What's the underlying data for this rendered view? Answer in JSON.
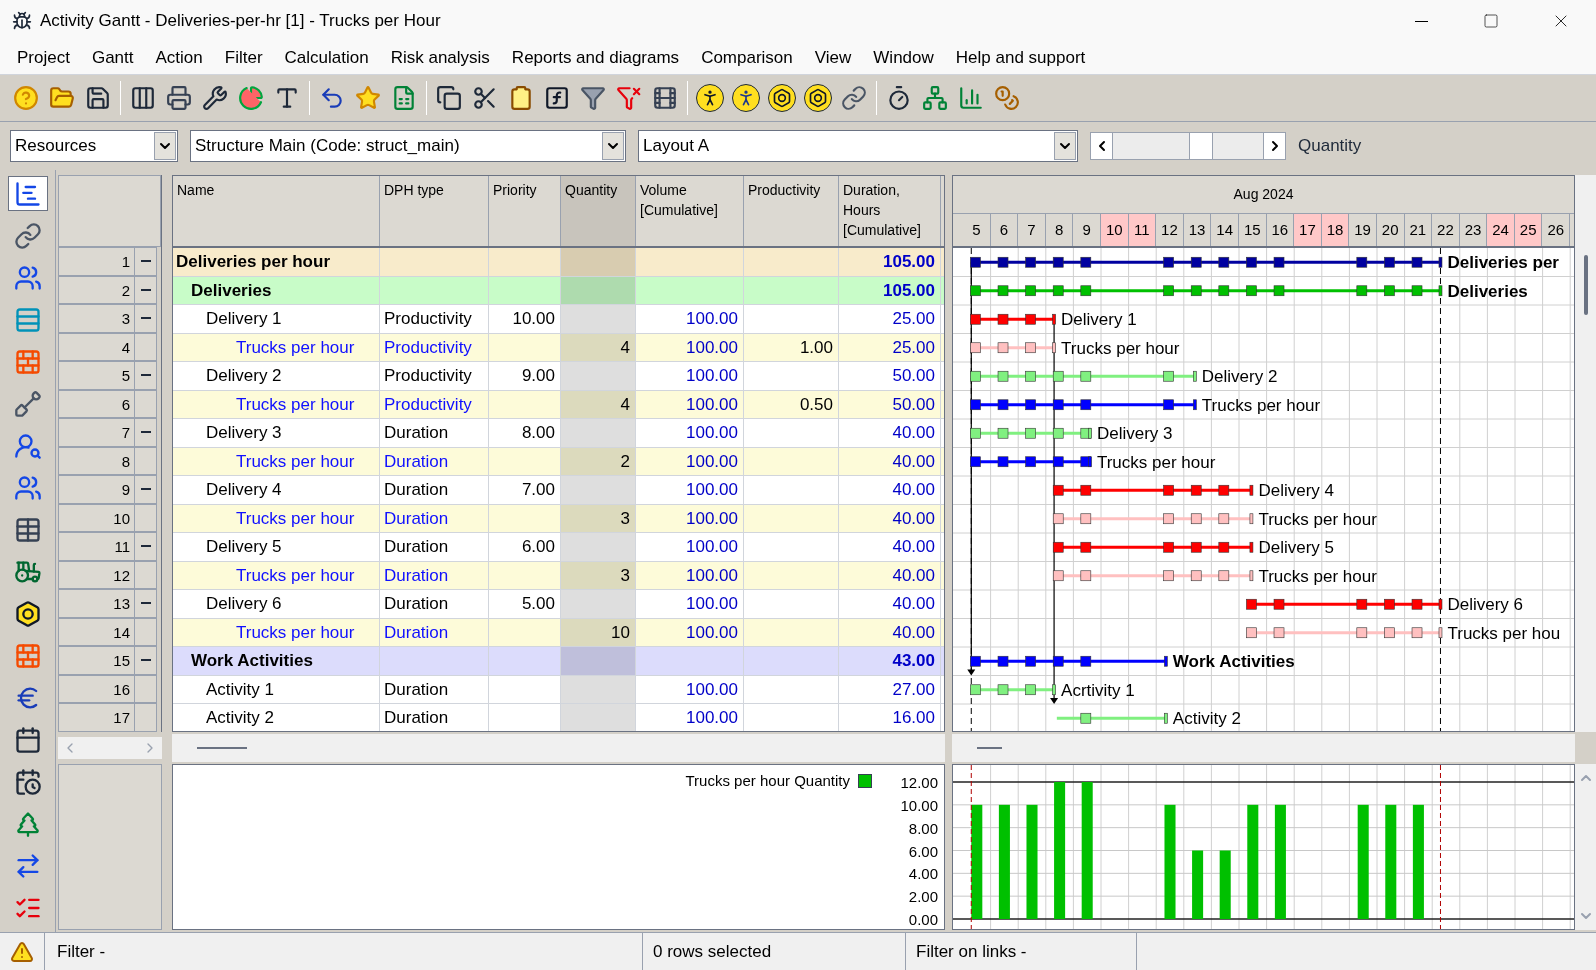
{
  "window": {
    "title": "Activity Gantt - Deliveries-per-hr [1] - Trucks per Hour"
  },
  "menu": [
    "Project",
    "Gantt",
    "Action",
    "Filter",
    "Calculation",
    "Risk analysis",
    "Reports and diagrams",
    "Comparison",
    "View",
    "Window",
    "Help and support"
  ],
  "selectors": [
    {
      "value": "Resources"
    },
    {
      "value": "Structure Main (Code: struct_main)"
    },
    {
      "value": "Layout A"
    }
  ],
  "view_label": "Quantity",
  "columns": [
    {
      "label": "Name"
    },
    {
      "label": "DPH type"
    },
    {
      "label": "Priority"
    },
    {
      "label": "Quantity"
    },
    {
      "label": "Volume\n[Cumulative]"
    },
    {
      "label": "Productivity"
    },
    {
      "label": "Duration,\nHours\n[Cumulative]"
    }
  ],
  "timeline": {
    "month": "Aug 2024",
    "days": [
      {
        "label": "5",
        "weekend": false
      },
      {
        "label": "6",
        "weekend": false
      },
      {
        "label": "7",
        "weekend": false
      },
      {
        "label": "8",
        "weekend": false
      },
      {
        "label": "9",
        "weekend": false
      },
      {
        "label": "10",
        "weekend": true
      },
      {
        "label": "11",
        "weekend": true
      },
      {
        "label": "12",
        "weekend": false
      },
      {
        "label": "13",
        "weekend": false
      },
      {
        "label": "14",
        "weekend": false
      },
      {
        "label": "15",
        "weekend": false
      },
      {
        "label": "16",
        "weekend": false
      },
      {
        "label": "17",
        "weekend": true
      },
      {
        "label": "18",
        "weekend": true
      },
      {
        "label": "19",
        "weekend": false
      },
      {
        "label": "20",
        "weekend": false
      },
      {
        "label": "21",
        "weekend": false
      },
      {
        "label": "22",
        "weekend": false
      },
      {
        "label": "23",
        "weekend": false
      },
      {
        "label": "24",
        "weekend": true
      },
      {
        "label": "25",
        "weekend": true
      },
      {
        "label": "26",
        "weekend": false
      }
    ]
  },
  "rows": [
    {
      "number": "1",
      "kind": "group",
      "color": "#f8ebcb",
      "name": "Deliveries per hour",
      "duration": "105.00",
      "bar": {
        "label": "Deliveries per",
        "color": "#0000a0"
      },
      "children": [
        {
          "number": "2",
          "kind": "group",
          "color": "#c8fcc8",
          "name": "Deliveries",
          "duration": "105.00",
          "bar": {
            "label": "Deliveries",
            "color": "#00c000"
          },
          "children": [
            {
              "number": "3",
              "kind": "task",
              "name": "Delivery 1",
              "dph_type": "Productivity",
              "priority": "10.00",
              "volume": "100.00",
              "duration": "25.00",
              "bar": {
                "label": "Delivery 1",
                "color": "#ff0000"
              },
              "children": [
                {
                  "number": "4",
                  "kind": "resource",
                  "name": "Trucks per hour",
                  "dph_type": "Productivity",
                  "quantity": "4",
                  "volume": "100.00",
                  "productivity": "1.00",
                  "duration": "25.00",
                  "bar": {
                    "label": "Trucks per hour",
                    "color": "#ffc0c0"
                  }
                }
              ]
            },
            {
              "number": "5",
              "kind": "task",
              "name": "Delivery 2",
              "dph_type": "Productivity",
              "priority": "9.00",
              "volume": "100.00",
              "duration": "50.00",
              "bar": {
                "label": "Delivery 2",
                "color": "#80f080"
              },
              "children": [
                {
                  "number": "6",
                  "kind": "resource",
                  "name": "Trucks per hour",
                  "dph_type": "Productivity",
                  "quantity": "4",
                  "volume": "100.00",
                  "productivity": "0.50",
                  "duration": "50.00",
                  "bar": {
                    "label": "Trucks per hour",
                    "color": "#0000ff"
                  }
                }
              ]
            },
            {
              "number": "7",
              "kind": "task",
              "name": "Delivery 3",
              "dph_type": "Duration",
              "priority": "8.00",
              "volume": "100.00",
              "duration": "40.00",
              "bar": {
                "label": "Delivery 3",
                "color": "#80f080"
              },
              "children": [
                {
                  "number": "8",
                  "kind": "resource",
                  "name": "Trucks per hour",
                  "dph_type": "Duration",
                  "quantity": "2",
                  "volume": "100.00",
                  "duration": "40.00",
                  "bar": {
                    "label": "Trucks per hour",
                    "color": "#0000ff"
                  }
                }
              ]
            },
            {
              "number": "9",
              "kind": "task",
              "name": "Delivery 4",
              "dph_type": "Duration",
              "priority": "7.00",
              "volume": "100.00",
              "duration": "40.00",
              "bar": {
                "label": "Delivery 4",
                "color": "#ff0000"
              },
              "children": [
                {
                  "number": "10",
                  "kind": "resource",
                  "name": "Trucks per hour",
                  "dph_type": "Duration",
                  "quantity": "3",
                  "volume": "100.00",
                  "duration": "40.00",
                  "bar": {
                    "label": "Trucks per hour",
                    "color": "#ffc0c0"
                  }
                }
              ]
            },
            {
              "number": "11",
              "kind": "task",
              "name": "Delivery 5",
              "dph_type": "Duration",
              "priority": "6.00",
              "volume": "100.00",
              "duration": "40.00",
              "bar": {
                "label": "Delivery 5",
                "color": "#ff0000"
              },
              "children": [
                {
                  "number": "12",
                  "kind": "resource",
                  "name": "Trucks per hour",
                  "dph_type": "Duration",
                  "quantity": "3",
                  "volume": "100.00",
                  "duration": "40.00",
                  "bar": {
                    "label": "Trucks per hour",
                    "color": "#ffc0c0"
                  }
                }
              ]
            },
            {
              "number": "13",
              "kind": "task",
              "name": "Delivery 6",
              "dph_type": "Duration",
              "priority": "5.00",
              "volume": "100.00",
              "duration": "40.00",
              "bar": {
                "label": "Delivery 6",
                "color": "#ff0000"
              },
              "children": [
                {
                  "number": "14",
                  "kind": "resource",
                  "name": "Trucks per hour",
                  "dph_type": "Duration",
                  "quantity": "10",
                  "volume": "100.00",
                  "duration": "40.00",
                  "bar": {
                    "label": "Trucks per hou",
                    "color": "#ffc0c0"
                  }
                }
              ]
            }
          ]
        },
        {
          "number": "15",
          "kind": "group",
          "color": "#dcdcfc",
          "name": "Work Activities",
          "duration": "43.00",
          "bar": {
            "label": "Work Activities",
            "color": "#0000ff"
          },
          "children": [
            {
              "number": "16",
              "kind": "task",
              "name": "Activity 1",
              "dph_type": "Duration",
              "volume": "100.00",
              "duration": "27.00",
              "bar": {
                "label": "Acrtivity 1",
                "color": "#80f080"
              }
            },
            {
              "number": "17",
              "kind": "task",
              "name": "Activity 2",
              "dph_type": "Duration",
              "volume": "100.00",
              "duration": "16.00",
              "bar": {
                "label": "Activity 2",
                "color": "#80f080"
              }
            }
          ]
        }
      ]
    }
  ],
  "histogram": {
    "chart_data": {
      "type": "bar",
      "grid": true,
      "series": [
        {
          "name": "Trucks per hour Quantity",
          "color": "#00c000",
          "values": [
            10,
            10,
            10,
            12,
            12,
            0,
            0,
            10,
            6,
            6,
            10,
            10,
            0,
            0,
            10,
            10,
            10,
            0,
            0,
            0,
            0,
            0
          ]
        }
      ],
      "ylim": [
        0,
        12
      ],
      "yticks": [
        {
          "value": 12,
          "label": "12.00"
        },
        {
          "value": 10,
          "label": "10.00"
        },
        {
          "value": 8,
          "label": "8.00"
        },
        {
          "value": 6,
          "label": "6.00"
        },
        {
          "value": 4,
          "label": "4.00"
        },
        {
          "value": 2,
          "label": "2.00"
        },
        {
          "value": 0,
          "label": "0.00"
        }
      ]
    }
  },
  "status_bar": {
    "filter": "Filter -",
    "selection": "0 rows selected",
    "link_filter": "Filter on links -"
  }
}
